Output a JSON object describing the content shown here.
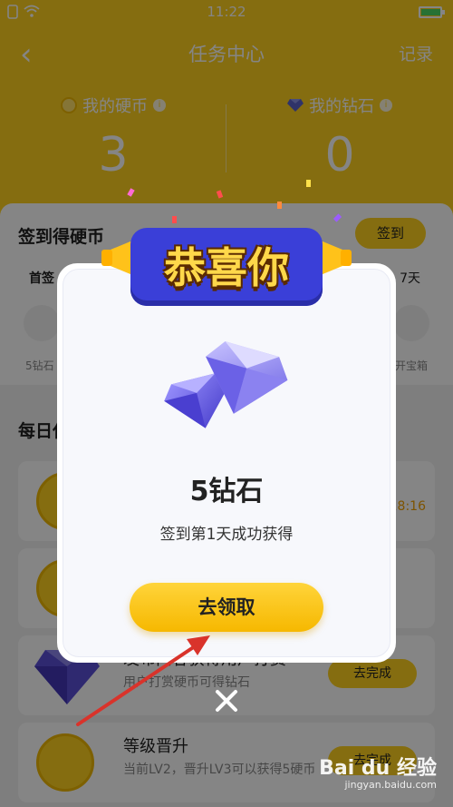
{
  "status_bar": {
    "time": "11:22",
    "battery_level": 0.95
  },
  "nav": {
    "back_glyph": "‹",
    "title": "任务中心",
    "record": "记录"
  },
  "stats": {
    "coins": {
      "label": "我的硬币",
      "value": "3",
      "icon": "coin-icon"
    },
    "diamonds": {
      "label": "我的钻石",
      "value": "0",
      "icon": "diamond-icon"
    }
  },
  "signin": {
    "heading": "签到得硬币",
    "button": "签到",
    "first_day": "首签",
    "last_day": "7天",
    "first_reward_label": "5钻石",
    "last_reward_label": "开宝箱"
  },
  "daily_section": {
    "title": "每日任务"
  },
  "tasks": [
    {
      "title": "",
      "desc": "",
      "timer": "18:16"
    },
    {
      "title": "",
      "desc": ""
    },
    {
      "title": "发布内容获得用户打赏",
      "desc": "用户打赏硬币可得钻石",
      "button": "去完成"
    },
    {
      "title": "等级晋升",
      "desc": "当前LV2，晋升LV3可以获得5硬币",
      "button": "去完成"
    }
  ],
  "modal": {
    "banner_text": "恭喜你",
    "reward_amount": "5钻石",
    "reward_desc": "签到第1天成功获得",
    "claim_button": "去领取",
    "close_glyph": "✕"
  },
  "watermark": {
    "brand": "Bai du 经验",
    "site": "jingyan.baidu.com"
  },
  "colors": {
    "primary_yellow": "#ffd21f",
    "diamond_purple": "#6f63e8",
    "annotation_arrow": "#d9332b",
    "banner_blue": "#3a3fd8"
  }
}
